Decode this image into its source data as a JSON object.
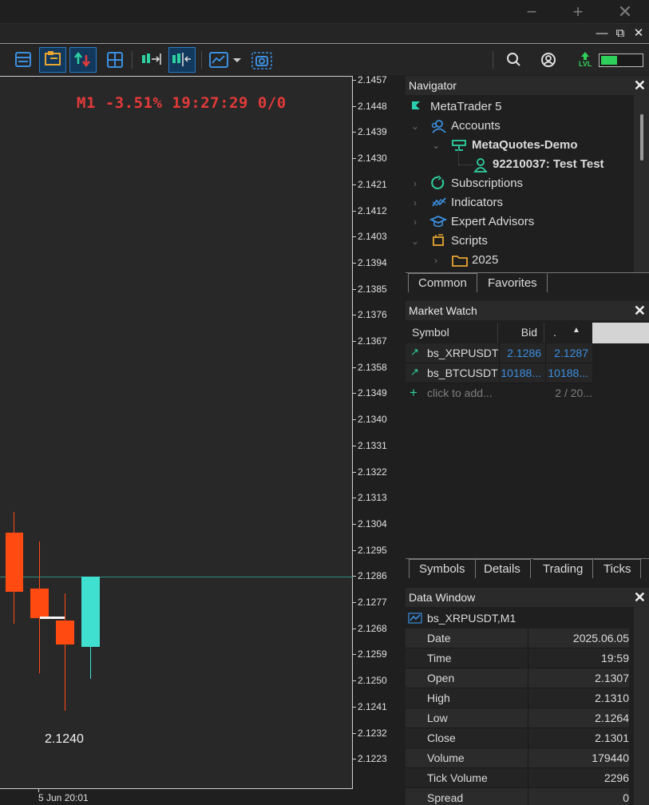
{
  "window": {
    "controls": {
      "minimize": "−",
      "maximize": "+",
      "close": "✕"
    },
    "mdi_controls": {
      "minimize": "—",
      "restore": "⧉",
      "close": "✕"
    }
  },
  "toolbar": {
    "buttons": [
      "market-watch",
      "navigator",
      "trading-signals",
      "tile-windows",
      "autoscroll",
      "chart-shift",
      "indicators",
      "screenshot"
    ],
    "right": {
      "search": "search",
      "account": "account",
      "level": "LVL"
    }
  },
  "chart": {
    "header": "M1 -3.51% 19:27:29 0/0",
    "last_price_note": "2.1240",
    "time_label": "5 Jun 20:01",
    "price_labels": [
      "2.1457",
      "2.1448",
      "2.1439",
      "2.1430",
      "2.1421",
      "2.1412",
      "2.1403",
      "2.1394",
      "2.1385",
      "2.1376",
      "2.1367",
      "2.1358",
      "2.1349",
      "2.1340",
      "2.1331",
      "2.1322",
      "2.1313",
      "2.1304",
      "2.1295",
      "2.1286",
      "2.1277",
      "2.1268",
      "2.1259",
      "2.1250",
      "2.1241",
      "2.1232",
      "2.1223"
    ],
    "colors": {
      "bear": "#ff4a12",
      "bull": "#40e0d0",
      "bid_line": "#2e8d7d",
      "header": "#e33a3a"
    }
  },
  "navigator": {
    "title": "Navigator",
    "close": "✕",
    "items": [
      {
        "label": "MetaTrader 5"
      },
      {
        "label": "Accounts"
      },
      {
        "label": "MetaQuotes-Demo"
      },
      {
        "label": "92210037: Test Test"
      },
      {
        "label": "Subscriptions"
      },
      {
        "label": "Indicators"
      },
      {
        "label": "Expert Advisors"
      },
      {
        "label": "Scripts"
      },
      {
        "label": "2025"
      }
    ],
    "tabs": [
      "Common",
      "Favorites"
    ]
  },
  "market_watch": {
    "title": "Market Watch",
    "close": "✕",
    "columns": [
      "Symbol",
      "Bid",
      "."
    ],
    "rows": [
      {
        "symbol": "bs_XRPUSDT",
        "bid": "2.1286",
        "ask": "2.1287"
      },
      {
        "symbol": "bs_BTCUSDT",
        "bid": "10188...",
        "ask": "10188..."
      }
    ],
    "add_placeholder": "click to add...",
    "count": "2 / 20...",
    "tabs": [
      "Symbols",
      "Details",
      "Trading",
      "Ticks"
    ]
  },
  "data_window": {
    "title": "Data Window",
    "close": "✕",
    "symbol": "bs_XRPUSDT,M1",
    "rows": [
      {
        "label": "Date",
        "value": "2025.06.05"
      },
      {
        "label": "Time",
        "value": "19:59"
      },
      {
        "label": "Open",
        "value": "2.1307"
      },
      {
        "label": "High",
        "value": "2.1310"
      },
      {
        "label": "Low",
        "value": "2.1264"
      },
      {
        "label": "Close",
        "value": "2.1301"
      },
      {
        "label": "Volume",
        "value": "179440"
      },
      {
        "label": "Tick Volume",
        "value": "2296"
      },
      {
        "label": "Spread",
        "value": "0"
      }
    ]
  }
}
